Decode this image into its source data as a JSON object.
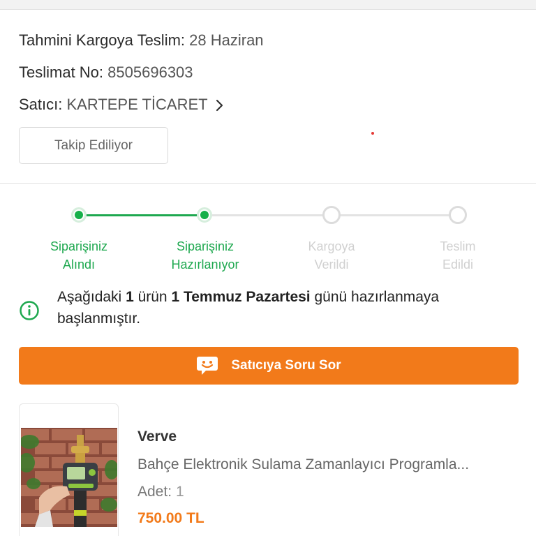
{
  "delivery": {
    "estimated_label": "Tahmini Kargoya Teslim:",
    "estimated_value": "28 Haziran",
    "tracking_label": "Teslimat No:",
    "tracking_value": "8505696303",
    "seller_label": "Satıcı:",
    "seller_value": "KARTEPE TİCARET",
    "follow_button": "Takip Ediliyor"
  },
  "tracker": {
    "steps": [
      {
        "line1": "Siparişiniz",
        "line2": "Alındı",
        "state": "done"
      },
      {
        "line1": "Siparişiniz",
        "line2": "Hazırlanıyor",
        "state": "done"
      },
      {
        "line1": "Kargoya",
        "line2": "Verildi",
        "state": "todo"
      },
      {
        "line1": "Teslim",
        "line2": "Edildi",
        "state": "todo"
      }
    ]
  },
  "notice": {
    "part1": "Aşağıdaki ",
    "count": "1",
    "part2": " ürün ",
    "date": "1 Temmuz Pazartesi",
    "part3": " günü hazırlanmaya başlanmıştır."
  },
  "ask_button": "Satıcıya Soru Sor",
  "product": {
    "brand": "Verve",
    "name": "Bahçe Elektronik Sulama Zamanlayıcı Programla...",
    "qty_label": "Adet:",
    "qty_value": "1",
    "price": "750.00 TL"
  },
  "colors": {
    "accent": "#f27a1a",
    "success": "#1ea84f",
    "inactive": "#d0d0d0"
  }
}
